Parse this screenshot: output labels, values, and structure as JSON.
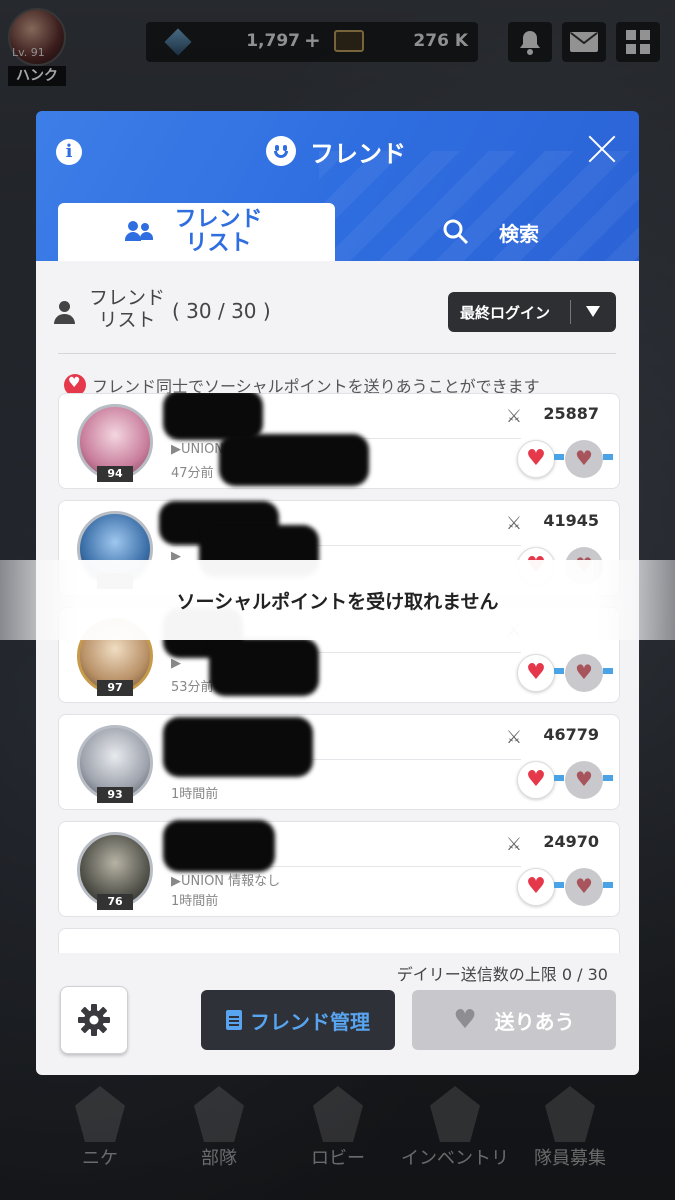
{
  "topbar": {
    "player_level": "Lv. 91",
    "player_name": "ハンク",
    "gems": "1,797",
    "gems_plus": "+",
    "credits": "276 K"
  },
  "dialog": {
    "title": "フレンド",
    "tab_friend_list": "フレンド\nリスト",
    "tab_search": "検索",
    "list_title": "フレンド\nリスト",
    "list_count": "( 30 / 30 )",
    "sort_label": "最終ログイン",
    "info_text": "フレンド同士でソーシャルポイントを送りあうことができます",
    "friends": [
      {
        "level": "94",
        "power": "25887",
        "union": "▶UNION",
        "last_login": "47分前"
      },
      {
        "level": "",
        "power": "41945",
        "union": "▶",
        "last_login": ""
      },
      {
        "level": "97",
        "power": "",
        "union": "▶",
        "last_login": "53分前"
      },
      {
        "level": "93",
        "power": "46779",
        "union": "",
        "last_login": "1時間前"
      },
      {
        "level": "76",
        "power": "24970",
        "union": "▶UNION 情報なし",
        "last_login": "1時間前"
      }
    ],
    "daily_limit": "デイリー送信数の上限 0 / 30",
    "manage_button": "フレンド管理",
    "send_all_button": "送りあう"
  },
  "toast": {
    "message": "ソーシャルポイントを受け取れません"
  },
  "bottom_nav": {
    "items": [
      "ニケ",
      "部隊",
      "ロビー",
      "インベントリ",
      "隊員募集"
    ]
  },
  "colors": {
    "header_blue": "#2f6ee0",
    "heart_red": "#e5394b",
    "arrow_blue": "#49a3e6"
  }
}
